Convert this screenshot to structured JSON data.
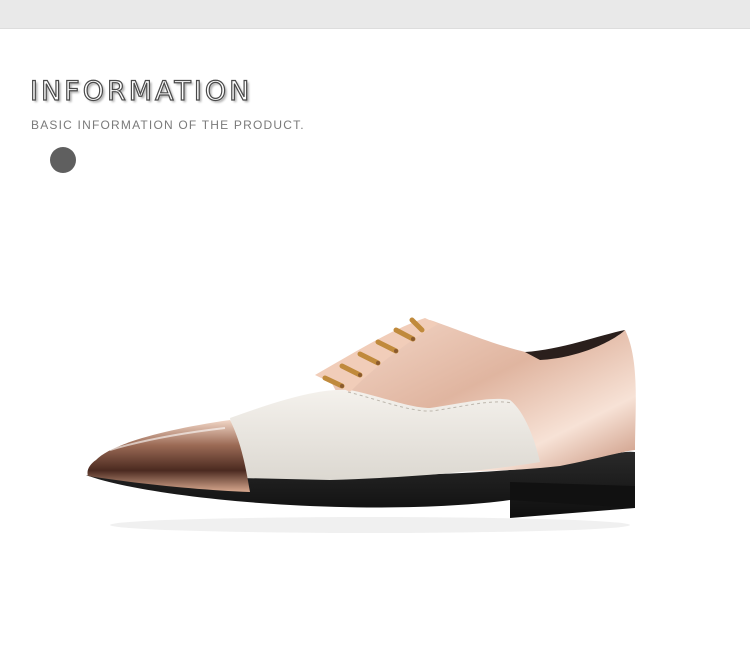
{
  "header": {
    "title": "INFORMATION",
    "subtitle": "BASIC INFORMATION OF THE PRODUCT."
  },
  "product_image": {
    "subject": "shoe-illustration"
  },
  "colors": {
    "background": "#ffffff",
    "top_band": "#e9e9e9",
    "title_outline": "#4a4a4a",
    "subtitle": "#7a7a7a",
    "dot": "#5f5f5f",
    "toe_cap": "#7a4e3a",
    "vamp": "#efece6",
    "upper_rose_gold": "#e7c2ae",
    "laces": "#c08a3c",
    "sole": "#1e1e1e"
  }
}
